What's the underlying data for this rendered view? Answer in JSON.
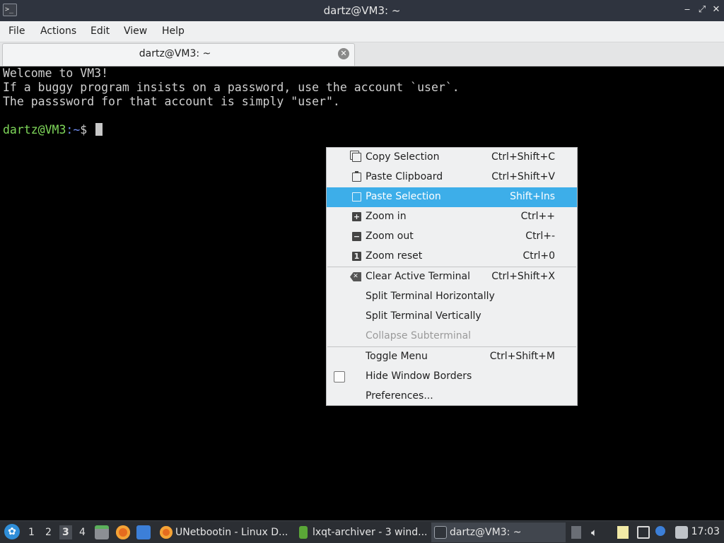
{
  "window": {
    "title": "dartz@VM3: ~",
    "minimize_glyph": "‒",
    "maximize_glyph": "⤢",
    "close_glyph": "✕"
  },
  "menubar": {
    "file": "File",
    "actions": "Actions",
    "edit": "Edit",
    "view": "View",
    "help": "Help"
  },
  "tab": {
    "title": "dartz@VM3: ~",
    "close_glyph": "✕"
  },
  "terminal": {
    "lines": [
      "Welcome to VM3!",
      "If a buggy program insists on a password, use the account `user`.",
      "The passsword for that account is simply \"user\"."
    ],
    "prompt_user": "dartz@VM3",
    "prompt_sep": ":",
    "prompt_path": "~",
    "prompt_symbol": "$ "
  },
  "context_menu": {
    "items": [
      {
        "label": "Copy Selection",
        "shortcut": "Ctrl+Shift+C",
        "icon": "copy-icon"
      },
      {
        "label": "Paste Clipboard",
        "shortcut": "Ctrl+Shift+V",
        "icon": "paste-icon"
      },
      {
        "label": "Paste Selection",
        "shortcut": "Shift+Ins",
        "icon": "paste-icon",
        "highlighted": true
      },
      {
        "label": "Zoom in",
        "shortcut": "Ctrl++",
        "icon": "zoom-in-icon",
        "glyph": "+"
      },
      {
        "label": "Zoom out",
        "shortcut": "Ctrl+-",
        "icon": "zoom-out-icon",
        "glyph": "−"
      },
      {
        "label": "Zoom reset",
        "shortcut": "Ctrl+0",
        "icon": "zoom-reset-icon",
        "glyph": "1"
      },
      {
        "label": "Clear Active Terminal",
        "shortcut": "Ctrl+Shift+X",
        "icon": "clear-icon",
        "glyph": "✕"
      },
      {
        "label": "Split Terminal Horizontally",
        "shortcut": ""
      },
      {
        "label": "Split Terminal Vertically",
        "shortcut": ""
      },
      {
        "label": "Collapse Subterminal",
        "shortcut": "",
        "disabled": true
      },
      {
        "label": "Toggle Menu",
        "shortcut": "Ctrl+Shift+M"
      },
      {
        "label": "Hide Window Borders",
        "shortcut": "",
        "checkbox": false
      },
      {
        "label": "Preferences...",
        "shortcut": ""
      }
    ]
  },
  "taskbar": {
    "start_glyph": "✿",
    "desktops": [
      "1",
      "2",
      "3",
      "4"
    ],
    "active_desktop": "3",
    "tasks": [
      {
        "label": "UNetbootin - Linux D..."
      },
      {
        "label": "lxqt-archiver - 3 wind..."
      },
      {
        "label": "dartz@VM3: ~"
      }
    ],
    "clock": "17:03",
    "colors": {
      "highlight": "#3daee9",
      "prompt_user": "#7fd85a",
      "prompt_path": "#6f8cf0"
    }
  }
}
